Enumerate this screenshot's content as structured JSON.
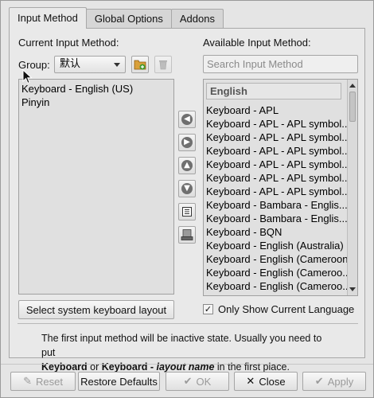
{
  "tabs": [
    {
      "label": "Input Method",
      "active": true
    },
    {
      "label": "Global Options",
      "active": false
    },
    {
      "label": "Addons",
      "active": false
    }
  ],
  "left": {
    "title": "Current Input Method:",
    "group_label": "Group:",
    "group_value": "默认",
    "items": [
      "Keyboard - English (US)",
      "Pinyin"
    ]
  },
  "right": {
    "title": "Available Input Method:",
    "search_placeholder": "Search Input Method",
    "group_header": "English",
    "items": [
      "Keyboard - APL",
      "Keyboard - APL - APL symbol...",
      "Keyboard - APL - APL symbol...",
      "Keyboard - APL - APL symbol...",
      "Keyboard - APL - APL symbol...",
      "Keyboard - APL - APL symbol...",
      "Keyboard - APL - APL symbol...",
      "Keyboard - Bambara - Englis...",
      "Keyboard - Bambara - Englis...",
      "Keyboard - BQN",
      "Keyboard - English (Australia)",
      "Keyboard - English (Cameroon)",
      "Keyboard - English (Cameroo...",
      "Keyboard - English (Cameroo..."
    ],
    "only_show_label": "Only Show Current Language",
    "only_show_checked": true
  },
  "select_layout_button": "Select system keyboard layout",
  "info": {
    "line1": "The first input method will be inactive state. Usually you need to put",
    "kw1": "Keyboard",
    "or": " or ",
    "kw2": "Keyboard - ",
    "kw3": "layout name",
    "tail": " in the first place."
  },
  "buttons": {
    "reset": "Reset",
    "restore": "Restore Defaults",
    "ok": "OK",
    "close": "Close",
    "apply": "Apply"
  }
}
